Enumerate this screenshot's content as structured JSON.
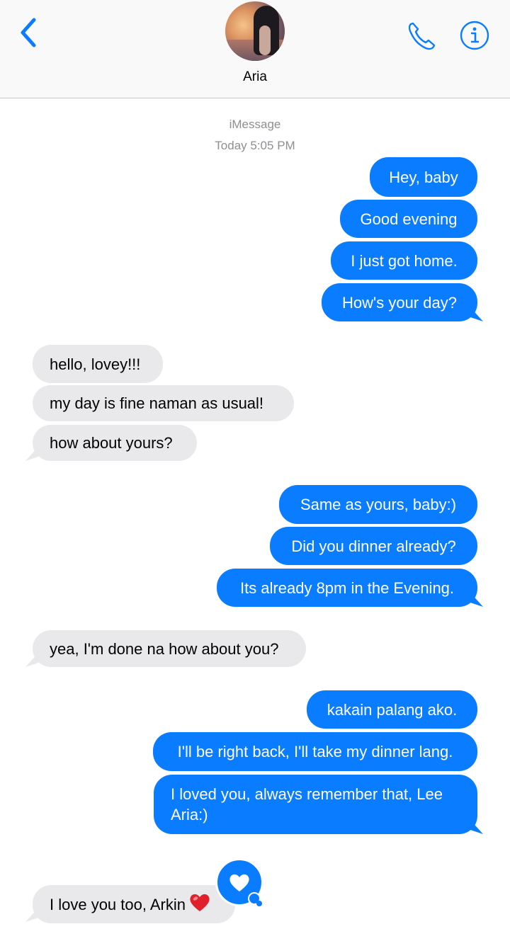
{
  "contact": {
    "name": "Aria"
  },
  "thread": {
    "service": "iMessage",
    "timestamp": "Today 5:05 PM"
  },
  "colors": {
    "sent": "#0a7cff",
    "received": "#e9e9eb",
    "accent": "#0a7cff"
  },
  "icons": {
    "back": "chevron-left-icon",
    "call": "phone-icon",
    "details": "info-icon",
    "reaction": "heart-icon"
  },
  "messages": [
    {
      "from": "me",
      "text": "Hey, baby"
    },
    {
      "from": "me",
      "text": "Good evening"
    },
    {
      "from": "me",
      "text": "I just got home."
    },
    {
      "from": "me",
      "text": "How's your day?"
    },
    {
      "from": "them",
      "text": "hello, lovey!!!"
    },
    {
      "from": "them",
      "text": "my day is fine naman as usual!"
    },
    {
      "from": "them",
      "text": "how about yours?"
    },
    {
      "from": "me",
      "text": "Same as yours, baby:)"
    },
    {
      "from": "me",
      "text": "Did you dinner already?"
    },
    {
      "from": "me",
      "text": "Its already 8pm in the Evening."
    },
    {
      "from": "them",
      "text": "yea, I'm done na how about you?"
    },
    {
      "from": "me",
      "text": "kakain palang ako."
    },
    {
      "from": "me",
      "text": "I'll be right back, I'll take my dinner lang."
    },
    {
      "from": "me",
      "text": "I loved you, always remember that, Lee Aria:)"
    },
    {
      "from": "them",
      "text": "I love you too, Arkin",
      "emoji": "❤️",
      "reaction": "heart"
    }
  ]
}
